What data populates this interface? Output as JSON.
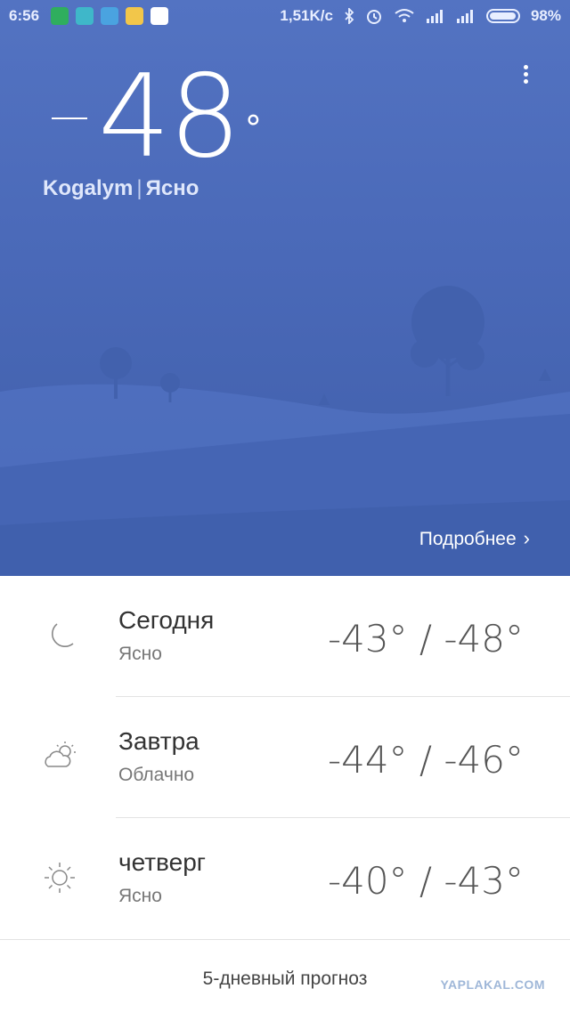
{
  "status_bar": {
    "time": "6:56",
    "network_speed": "1,51K/c",
    "battery": "98%",
    "battery_level": 0.98,
    "icons": [
      "shield-app-icon",
      "clock-app-icon",
      "upload-icon",
      "weather-app-icon",
      "play-store-icon",
      "bluetooth-icon",
      "alarm-icon",
      "wifi-icon",
      "signal-icon",
      "signal-icon",
      "battery-icon"
    ]
  },
  "current": {
    "temperature": "48",
    "degree_symbol": "°",
    "city": "Kogalym",
    "separator": "|",
    "condition": "Ясно"
  },
  "details_link": {
    "label": "Подробнее",
    "chevron": "›"
  },
  "forecast": [
    {
      "day": "Сегодня",
      "condition": "Ясно",
      "temps": "-43° / -48°",
      "icon": "moon-icon"
    },
    {
      "day": "Завтра",
      "condition": "Облачно",
      "temps": "-44° / -46°",
      "icon": "partly-cloudy-icon"
    },
    {
      "day": "четверг",
      "condition": "Ясно",
      "temps": "-40° / -43°",
      "icon": "sun-icon"
    }
  ],
  "five_day_link": "5-дневный прогноз",
  "watermark": "YAPLAKAL.COM",
  "colors": {
    "hero_top": "#5373c2",
    "hero_bottom": "#3f5ea9",
    "text_primary": "#333333",
    "text_secondary": "#777777"
  }
}
